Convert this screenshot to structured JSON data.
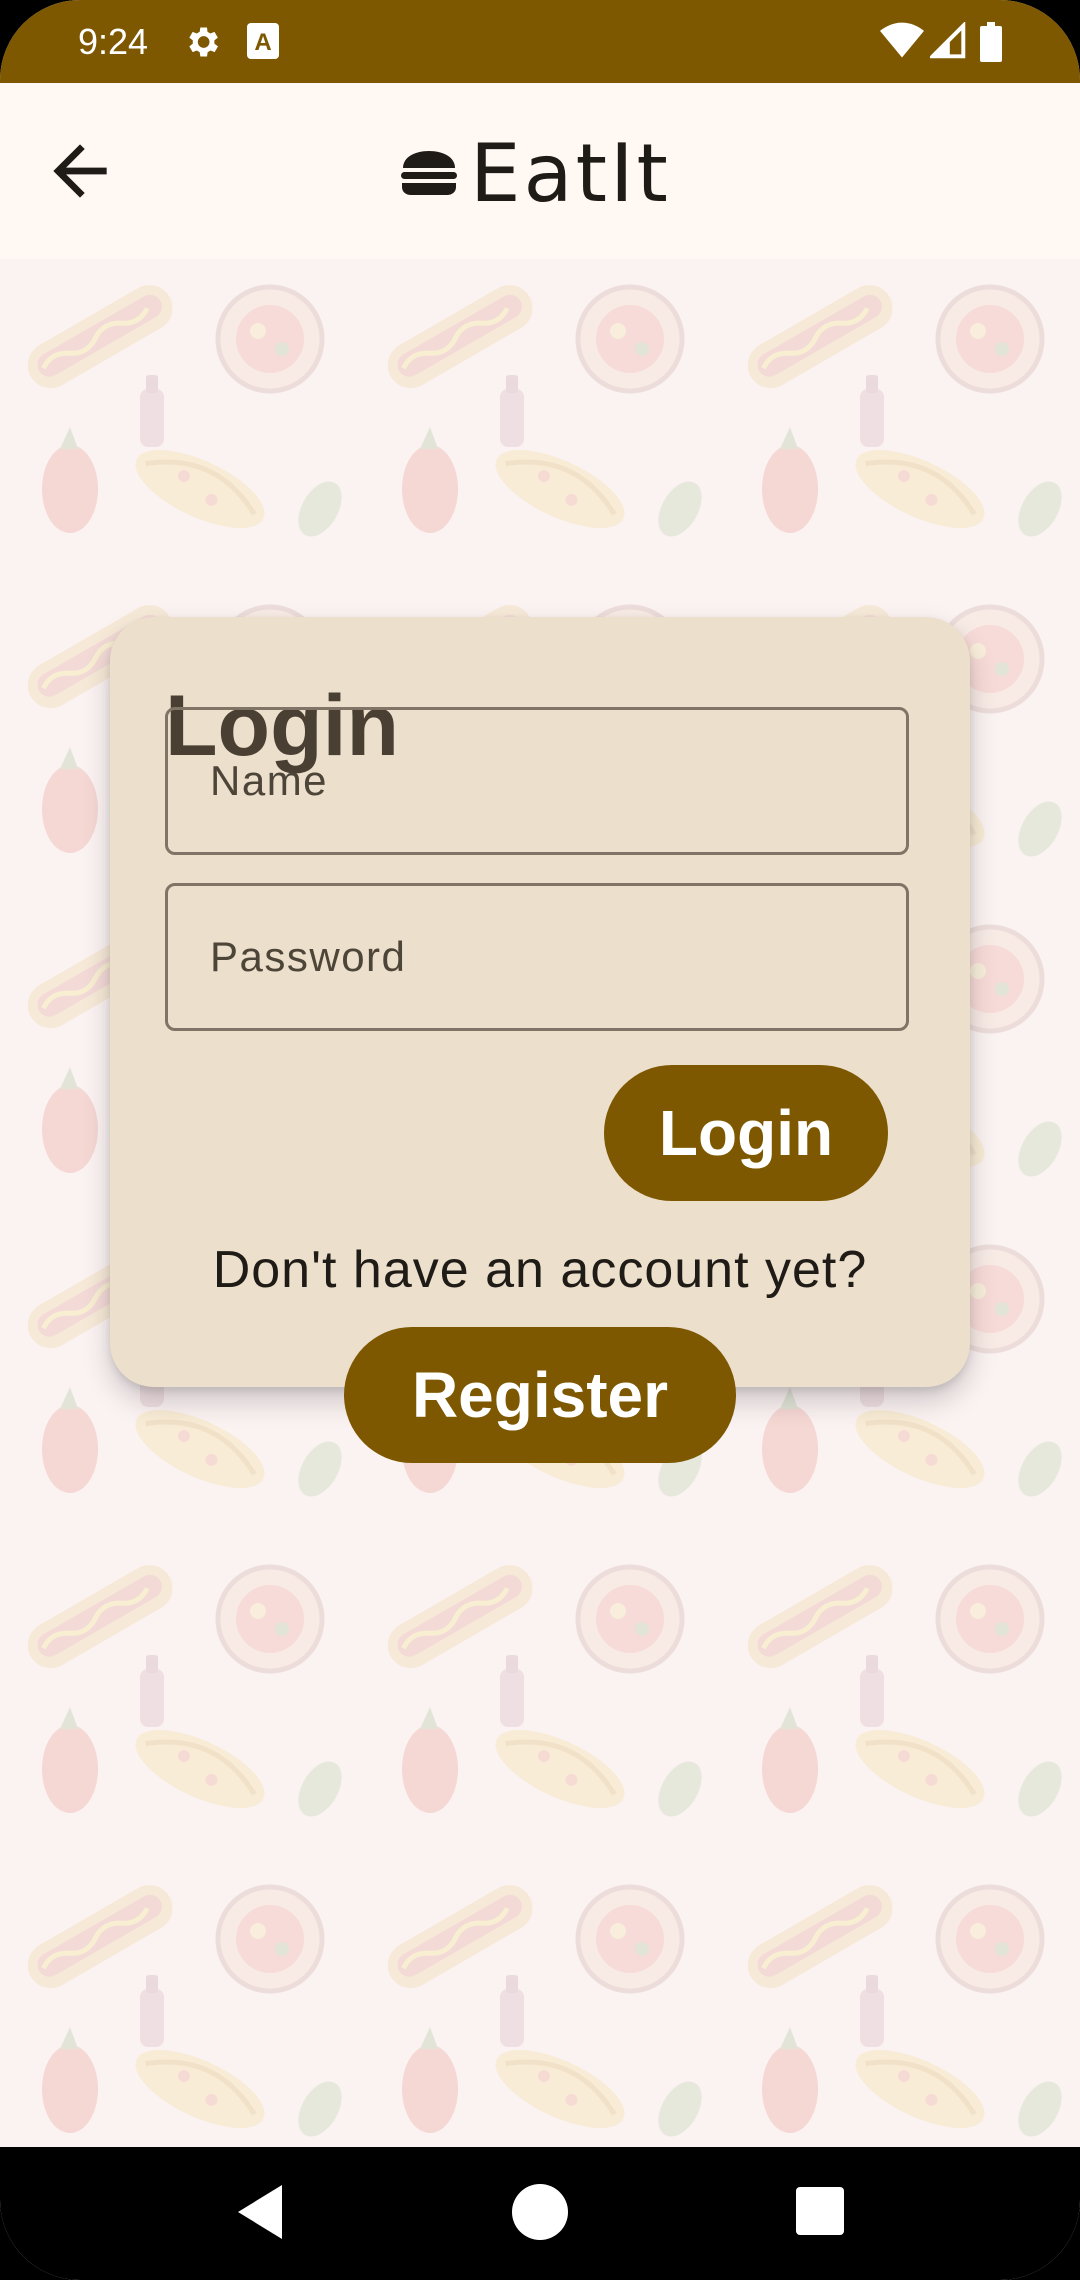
{
  "status_bar": {
    "time": "9:24",
    "icons": [
      "settings-icon",
      "font-a-icon",
      "wifi-icon",
      "signal-icon",
      "battery-icon"
    ]
  },
  "app_bar": {
    "back_icon": "arrow-back-icon",
    "logo_icon": "burger-icon",
    "title": "EatIt"
  },
  "login_card": {
    "heading": "Login",
    "name_placeholder": "Name",
    "password_placeholder": "Password",
    "login_button": "Login"
  },
  "register_section": {
    "prompt": "Don't have an account yet?",
    "register_button": "Register"
  },
  "nav_bar": {
    "icons": [
      "nav-back-icon",
      "nav-home-icon",
      "nav-recents-icon"
    ]
  },
  "colors": {
    "primary": "#7d5800",
    "card": "#ecdfcc",
    "app_bar": "#fff8f3",
    "text_dark": "#1f1b16"
  }
}
